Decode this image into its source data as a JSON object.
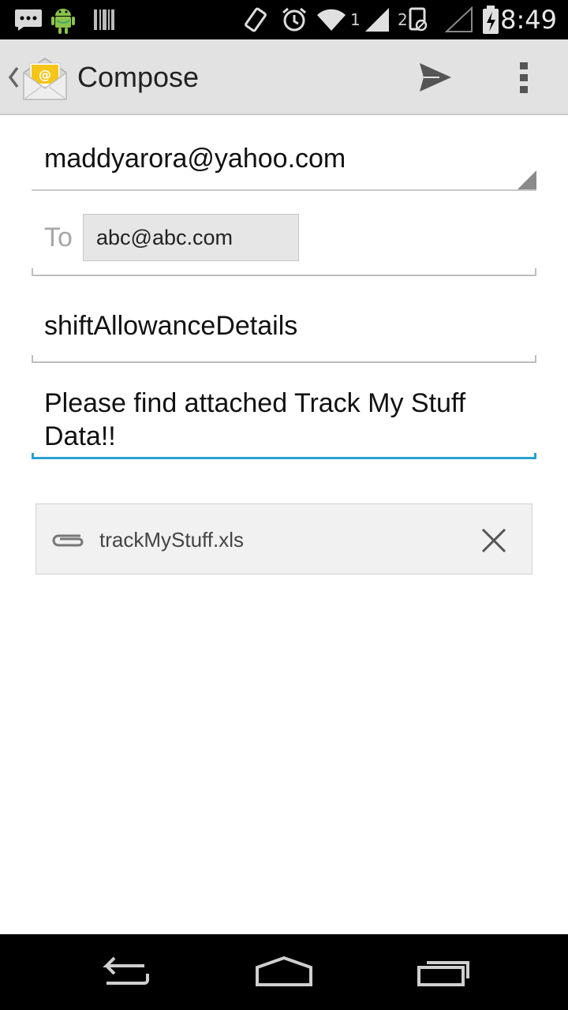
{
  "status_bar": {
    "icons": [
      "sms-notification-icon",
      "android-debug-icon",
      "barcode-icon",
      "vibrate-icon",
      "alarm-icon",
      "wifi-icon",
      "signal-sim1-icon",
      "signal-sim2-icon",
      "no-data-icon",
      "signal-empty-icon",
      "battery-charging-icon"
    ],
    "sim1_label": "1",
    "sim2_label": "2",
    "time": "8:49"
  },
  "action_bar": {
    "title": "Compose",
    "send_icon": "send-icon",
    "overflow_icon": "overflow-menu-icon"
  },
  "compose": {
    "from": "maddyarora@yahoo.com",
    "to_label": "To",
    "to_recipient": "abc@abc.com",
    "subject": "shiftAllowanceDetails",
    "body": "Please find attached Track My Stuff Data!!"
  },
  "attachment": {
    "name": "trackMyStuff.xls",
    "icon": "paperclip-icon",
    "remove_icon": "close-icon"
  },
  "nav_bar": {
    "buttons": [
      "back-icon",
      "home-icon",
      "recent-apps-icon"
    ]
  },
  "colors": {
    "action_bar_bg": "#e2e2e2",
    "focus_underline": "#2aa0cf",
    "chip_bg": "#e6e6e6",
    "attachment_bg": "#f1f1f1"
  }
}
